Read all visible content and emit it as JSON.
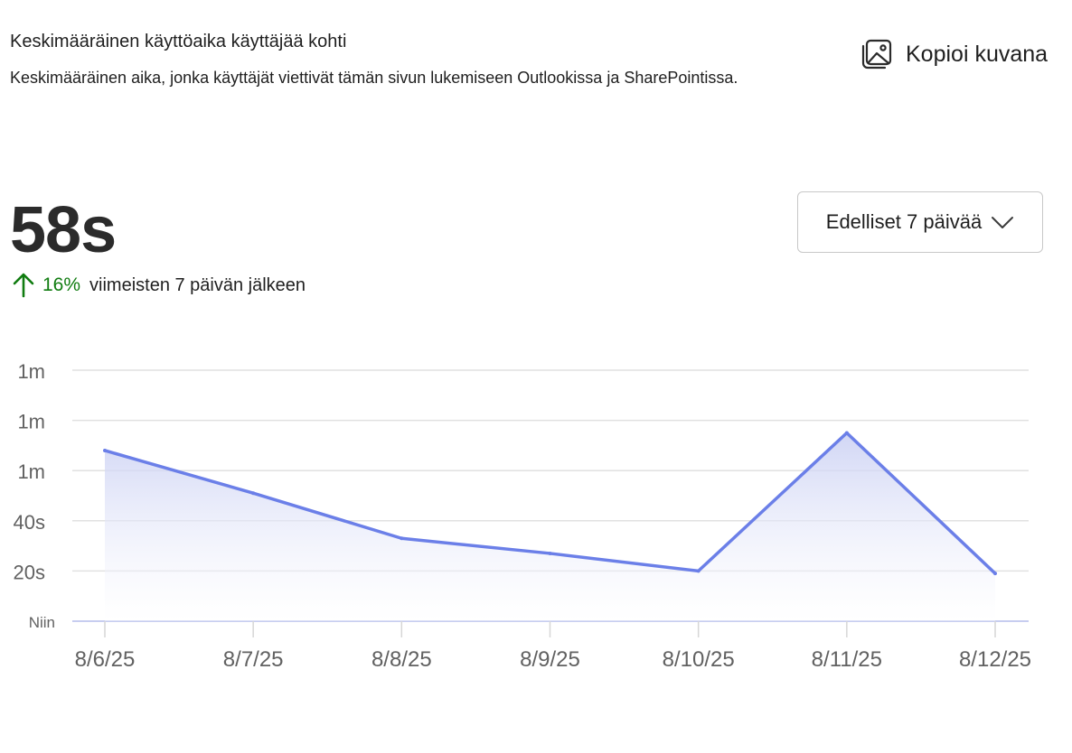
{
  "header": {
    "title": "Keskimääräinen käyttöaika käyttäjää kohti",
    "subtitle": "Keskimääräinen aika, jonka käyttäjät viettivät tämän sivun lukemiseen Outlookissa ja SharePointissa."
  },
  "copy_button": {
    "label": "Kopioi kuvana",
    "icon": "image-copy-icon"
  },
  "summary": {
    "value": "58s",
    "trend_icon": "arrow-up-icon",
    "trend_percent": "16%",
    "trend_suffix": "viimeisten 7 päivän jälkeen",
    "trend_color": "#107c10"
  },
  "period_dropdown": {
    "selected": "Edelliset 7 päivää",
    "icon": "chevron-down-icon"
  },
  "chart_data": {
    "type": "area",
    "x": [
      "8/6/25",
      "8/7/25",
      "8/8/25",
      "8/9/25",
      "8/10/25",
      "8/11/25",
      "8/12/25"
    ],
    "series": [
      {
        "values": [
          68,
          51,
          33,
          27,
          20,
          75,
          19
        ]
      }
    ],
    "y_ticks": [
      {
        "value": 0,
        "label": "Niin"
      },
      {
        "value": 20,
        "label": "20s"
      },
      {
        "value": 40,
        "label": "40s"
      },
      {
        "value": 60,
        "label": "1m"
      },
      {
        "value": 80,
        "label": "1m"
      },
      {
        "value": 100,
        "label": "1m"
      }
    ],
    "ylim": [
      0,
      100
    ],
    "grid": true,
    "line_color": "#6b7fe8",
    "fill_color": "#c9cff3"
  }
}
